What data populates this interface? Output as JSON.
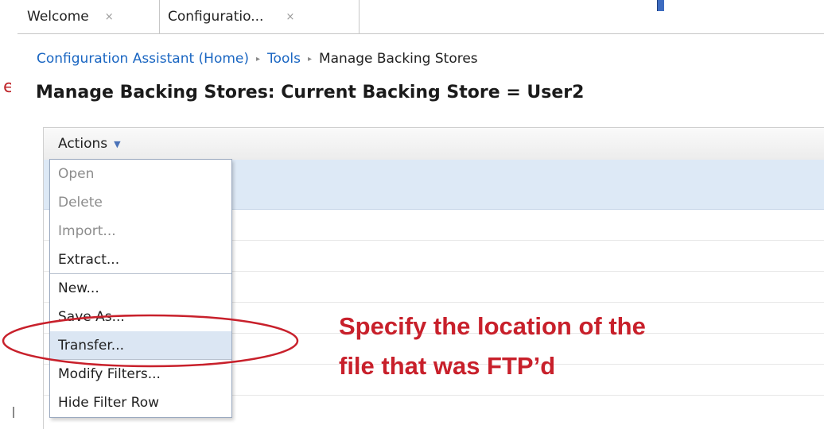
{
  "tabs": [
    {
      "label": "Welcome",
      "close": "×"
    },
    {
      "label": "Configuratio...",
      "close": "×"
    }
  ],
  "breadcrumb": {
    "home": "Configuration Assistant (Home)",
    "separator": "▸",
    "tools": "Tools",
    "current": "Manage Backing Stores"
  },
  "page_title": "Manage Backing Stores: Current Backing Store = User2",
  "toolbar": {
    "actions_label": "Actions",
    "caret": "▼"
  },
  "menu": {
    "items": [
      {
        "label": "Open",
        "disabled": true
      },
      {
        "label": "Delete",
        "disabled": true
      },
      {
        "label": "Import...",
        "disabled": true
      },
      {
        "label": "Extract...",
        "disabled": false
      },
      {
        "label": "New...",
        "disabled": false
      },
      {
        "label": "Save As...",
        "disabled": false
      },
      {
        "label": "Transfer...",
        "disabled": false,
        "highlighted": true
      },
      {
        "label": "Modify Filters...",
        "disabled": false
      },
      {
        "label": "Hide Filter Row",
        "disabled": false
      }
    ]
  },
  "annotation": {
    "line1": "Specify the location of the",
    "line2": "file that was FTP’d",
    "color": "#c8202b"
  },
  "colors": {
    "link": "#1a66c2",
    "header_row": "#dde9f6",
    "highlight": "#dbe6f3"
  }
}
